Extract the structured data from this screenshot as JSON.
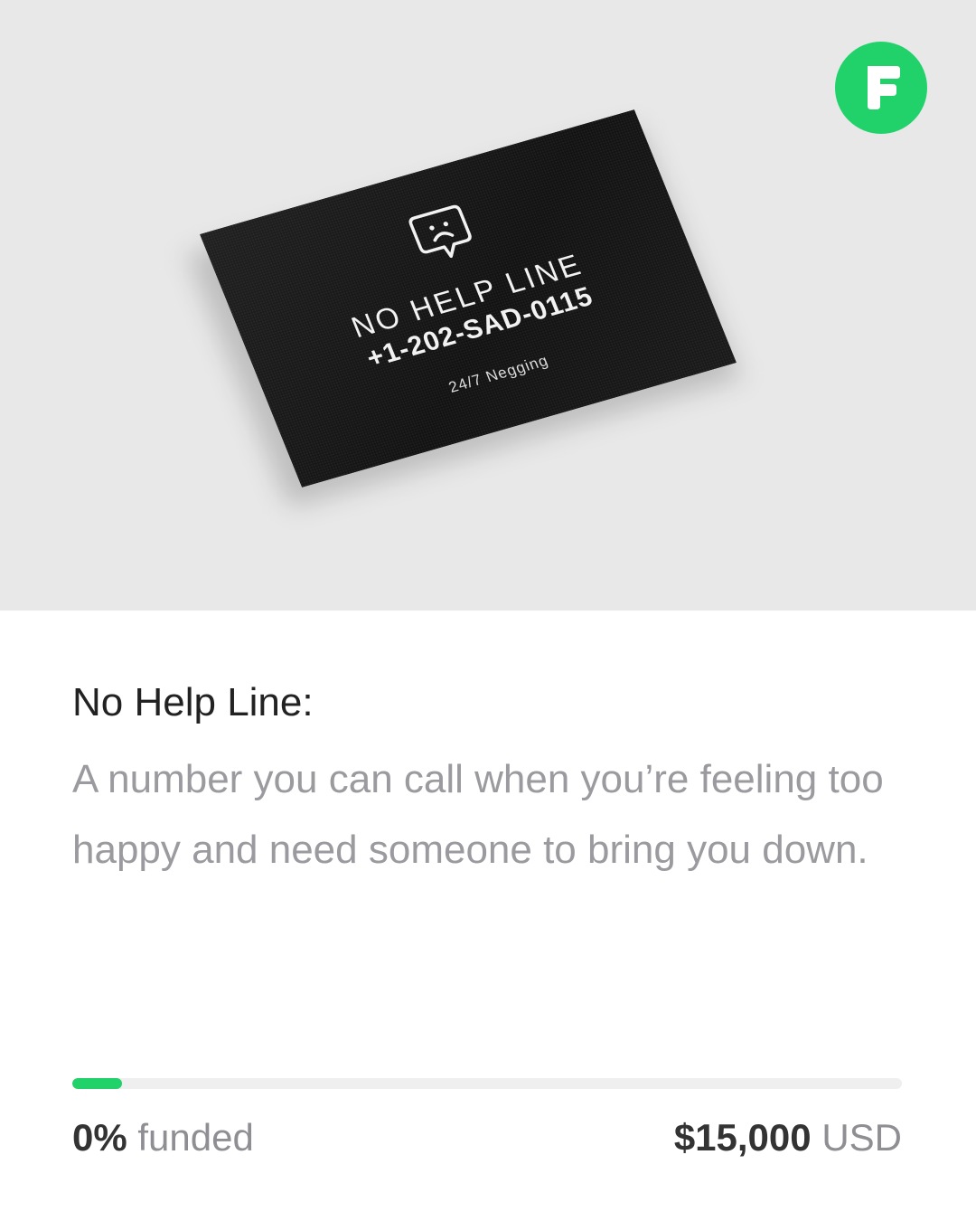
{
  "brand": {
    "logo_letter": "F",
    "accent_color": "#21d26a"
  },
  "card": {
    "icon": "sad-face-speech-bubble-icon",
    "title": "NO HELP LINE",
    "number": "+1-202-SAD-0115",
    "tagline": "24/7 Negging"
  },
  "campaign": {
    "title": "No Help Line:",
    "description": "A number you can call when you’re feeling too happy and need someone to bring you down."
  },
  "funding": {
    "percent_label": "0%",
    "funded_word": "funded",
    "progress_fraction": 0.06,
    "goal_amount": "$15,000",
    "goal_currency": "USD"
  }
}
